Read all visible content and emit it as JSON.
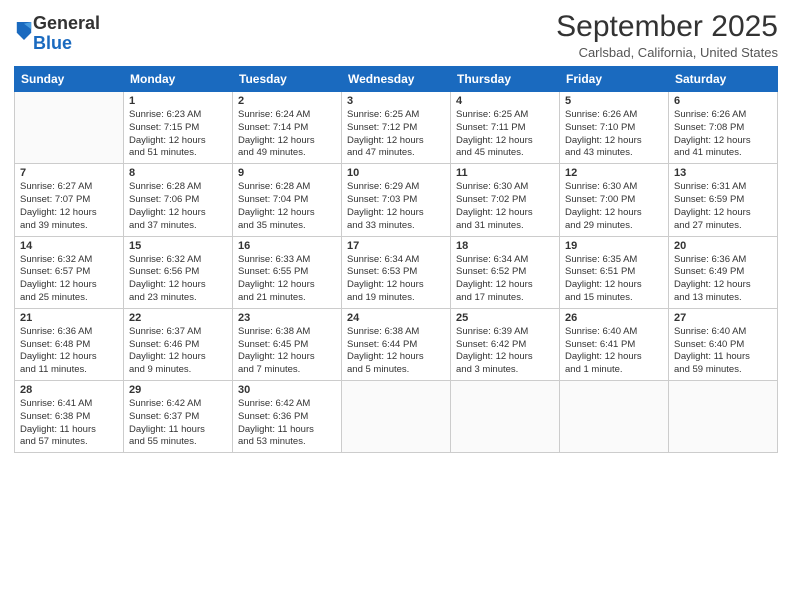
{
  "header": {
    "logo_general": "General",
    "logo_blue": "Blue",
    "month_title": "September 2025",
    "subtitle": "Carlsbad, California, United States"
  },
  "days_of_week": [
    "Sunday",
    "Monday",
    "Tuesday",
    "Wednesday",
    "Thursday",
    "Friday",
    "Saturday"
  ],
  "weeks": [
    [
      {
        "day": "",
        "info": ""
      },
      {
        "day": "1",
        "info": "Sunrise: 6:23 AM\nSunset: 7:15 PM\nDaylight: 12 hours\nand 51 minutes."
      },
      {
        "day": "2",
        "info": "Sunrise: 6:24 AM\nSunset: 7:14 PM\nDaylight: 12 hours\nand 49 minutes."
      },
      {
        "day": "3",
        "info": "Sunrise: 6:25 AM\nSunset: 7:12 PM\nDaylight: 12 hours\nand 47 minutes."
      },
      {
        "day": "4",
        "info": "Sunrise: 6:25 AM\nSunset: 7:11 PM\nDaylight: 12 hours\nand 45 minutes."
      },
      {
        "day": "5",
        "info": "Sunrise: 6:26 AM\nSunset: 7:10 PM\nDaylight: 12 hours\nand 43 minutes."
      },
      {
        "day": "6",
        "info": "Sunrise: 6:26 AM\nSunset: 7:08 PM\nDaylight: 12 hours\nand 41 minutes."
      }
    ],
    [
      {
        "day": "7",
        "info": "Sunrise: 6:27 AM\nSunset: 7:07 PM\nDaylight: 12 hours\nand 39 minutes."
      },
      {
        "day": "8",
        "info": "Sunrise: 6:28 AM\nSunset: 7:06 PM\nDaylight: 12 hours\nand 37 minutes."
      },
      {
        "day": "9",
        "info": "Sunrise: 6:28 AM\nSunset: 7:04 PM\nDaylight: 12 hours\nand 35 minutes."
      },
      {
        "day": "10",
        "info": "Sunrise: 6:29 AM\nSunset: 7:03 PM\nDaylight: 12 hours\nand 33 minutes."
      },
      {
        "day": "11",
        "info": "Sunrise: 6:30 AM\nSunset: 7:02 PM\nDaylight: 12 hours\nand 31 minutes."
      },
      {
        "day": "12",
        "info": "Sunrise: 6:30 AM\nSunset: 7:00 PM\nDaylight: 12 hours\nand 29 minutes."
      },
      {
        "day": "13",
        "info": "Sunrise: 6:31 AM\nSunset: 6:59 PM\nDaylight: 12 hours\nand 27 minutes."
      }
    ],
    [
      {
        "day": "14",
        "info": "Sunrise: 6:32 AM\nSunset: 6:57 PM\nDaylight: 12 hours\nand 25 minutes."
      },
      {
        "day": "15",
        "info": "Sunrise: 6:32 AM\nSunset: 6:56 PM\nDaylight: 12 hours\nand 23 minutes."
      },
      {
        "day": "16",
        "info": "Sunrise: 6:33 AM\nSunset: 6:55 PM\nDaylight: 12 hours\nand 21 minutes."
      },
      {
        "day": "17",
        "info": "Sunrise: 6:34 AM\nSunset: 6:53 PM\nDaylight: 12 hours\nand 19 minutes."
      },
      {
        "day": "18",
        "info": "Sunrise: 6:34 AM\nSunset: 6:52 PM\nDaylight: 12 hours\nand 17 minutes."
      },
      {
        "day": "19",
        "info": "Sunrise: 6:35 AM\nSunset: 6:51 PM\nDaylight: 12 hours\nand 15 minutes."
      },
      {
        "day": "20",
        "info": "Sunrise: 6:36 AM\nSunset: 6:49 PM\nDaylight: 12 hours\nand 13 minutes."
      }
    ],
    [
      {
        "day": "21",
        "info": "Sunrise: 6:36 AM\nSunset: 6:48 PM\nDaylight: 12 hours\nand 11 minutes."
      },
      {
        "day": "22",
        "info": "Sunrise: 6:37 AM\nSunset: 6:46 PM\nDaylight: 12 hours\nand 9 minutes."
      },
      {
        "day": "23",
        "info": "Sunrise: 6:38 AM\nSunset: 6:45 PM\nDaylight: 12 hours\nand 7 minutes."
      },
      {
        "day": "24",
        "info": "Sunrise: 6:38 AM\nSunset: 6:44 PM\nDaylight: 12 hours\nand 5 minutes."
      },
      {
        "day": "25",
        "info": "Sunrise: 6:39 AM\nSunset: 6:42 PM\nDaylight: 12 hours\nand 3 minutes."
      },
      {
        "day": "26",
        "info": "Sunrise: 6:40 AM\nSunset: 6:41 PM\nDaylight: 12 hours\nand 1 minute."
      },
      {
        "day": "27",
        "info": "Sunrise: 6:40 AM\nSunset: 6:40 PM\nDaylight: 11 hours\nand 59 minutes."
      }
    ],
    [
      {
        "day": "28",
        "info": "Sunrise: 6:41 AM\nSunset: 6:38 PM\nDaylight: 11 hours\nand 57 minutes."
      },
      {
        "day": "29",
        "info": "Sunrise: 6:42 AM\nSunset: 6:37 PM\nDaylight: 11 hours\nand 55 minutes."
      },
      {
        "day": "30",
        "info": "Sunrise: 6:42 AM\nSunset: 6:36 PM\nDaylight: 11 hours\nand 53 minutes."
      },
      {
        "day": "",
        "info": ""
      },
      {
        "day": "",
        "info": ""
      },
      {
        "day": "",
        "info": ""
      },
      {
        "day": "",
        "info": ""
      }
    ]
  ]
}
